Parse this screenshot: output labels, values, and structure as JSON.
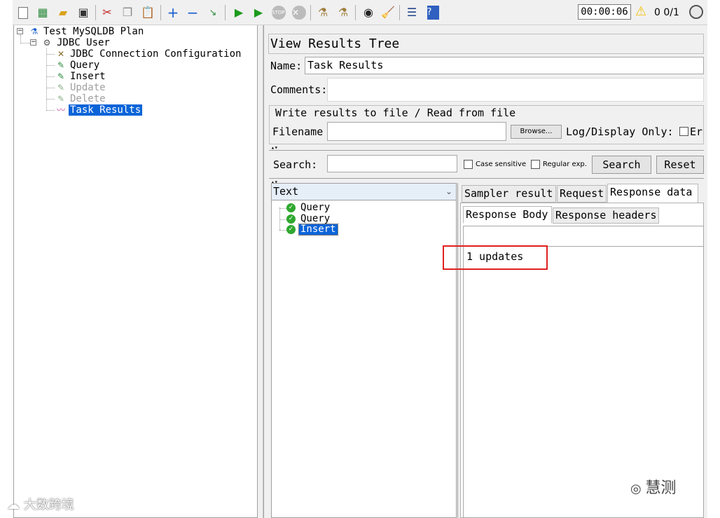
{
  "toolbar": {
    "icons": [
      "new-icon",
      "templates-icon",
      "open-icon",
      "save-icon",
      "cut-icon",
      "copy-icon",
      "paste-icon",
      "expand-icon",
      "collapse-icon",
      "toggle-icon",
      "start-icon",
      "start-no-pauses-icon",
      "stop-icon",
      "shutdown-icon",
      "clear-icon",
      "clear-all-icon",
      "search-icon",
      "reset-search-icon",
      "function-helper-icon",
      "help-icon"
    ],
    "timer": "00:00:06",
    "counts": "0 0/1"
  },
  "tree": {
    "plan": "Test MySQLDB Plan",
    "thread_group": "JDBC User",
    "items": [
      {
        "label": "JDBC Connection Configuration",
        "state": "enabled"
      },
      {
        "label": "Query",
        "state": "enabled"
      },
      {
        "label": "Insert",
        "state": "enabled"
      },
      {
        "label": "Update",
        "state": "disabled"
      },
      {
        "label": "Delete",
        "state": "disabled"
      },
      {
        "label": "Task Results",
        "state": "selected"
      }
    ]
  },
  "panel": {
    "title": "View Results Tree",
    "name_label": "Name:",
    "name_value": "Task Results",
    "comments_label": "Comments:",
    "file_section_title": "Write results to file / Read from file",
    "filename_label": "Filename",
    "browse_label": "Browse...",
    "log_display_label": "Log/Display Only:",
    "errors_label": "Er",
    "search_label": "Search:",
    "case_sensitive_label": "Case sensitive",
    "regex_label": "Regular exp.",
    "search_button": "Search",
    "reset_button": "Reset"
  },
  "results": {
    "renderer": "Text",
    "samples": [
      "Query",
      "Query",
      "Insert"
    ],
    "selected_index": 2
  },
  "tabs": {
    "outer": [
      "Sampler result",
      "Request",
      "Response data"
    ],
    "outer_active": "Response data",
    "inner": [
      "Response Body",
      "Response headers"
    ],
    "inner_active": "Response Body"
  },
  "response_body": "1 updates",
  "watermarks": {
    "left": "大数跨境",
    "right": "慧测"
  }
}
